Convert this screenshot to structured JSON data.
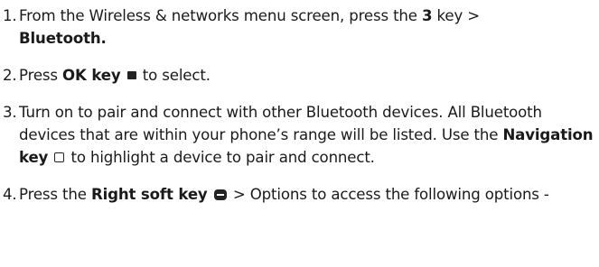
{
  "steps": [
    {
      "number": "1.",
      "text_1": "From the Wireless & networks menu screen, press the ",
      "bold_1": "3",
      "text_2": " key > ",
      "bold_2": "Bluetooth."
    },
    {
      "number": "2.",
      "text_1": "Press ",
      "bold_1": "OK key",
      "icon": "ok-key-icon",
      "text_2": " to select."
    },
    {
      "number": "3.",
      "text_1": "Turn on to pair and connect with other Bluetooth devices. All Bluetooth devices that are within your phone’s range will be listed. Use the ",
      "bold_1": "Navigation key",
      "icon": "navigation-key-icon",
      "text_2": " to highlight a device to pair and connect."
    },
    {
      "number": "4.",
      "text_1": "Press the ",
      "bold_1": "Right soft key",
      "icon": "right-soft-key-icon",
      "text_2": " > Options to access the following options -"
    }
  ]
}
